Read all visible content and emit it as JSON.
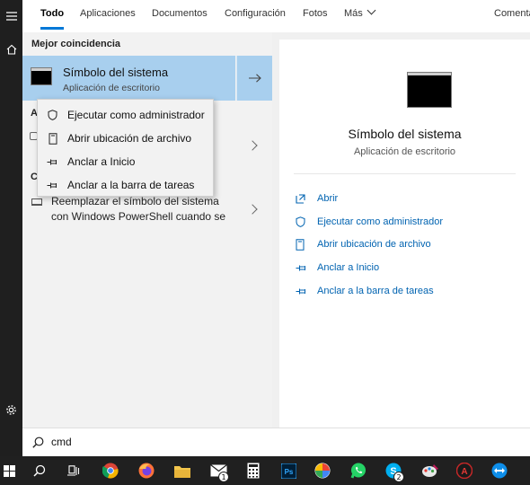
{
  "tabs": [
    {
      "label": "Todo",
      "active": true
    },
    {
      "label": "Aplicaciones"
    },
    {
      "label": "Documentos"
    },
    {
      "label": "Configuración"
    },
    {
      "label": "Fotos"
    },
    {
      "label": "Más"
    },
    {
      "label": "Comenta"
    }
  ],
  "results": {
    "best_match_title": "Mejor coincidencia",
    "best_match": {
      "title": "Símbolo del sistema",
      "subtitle": "Aplicación de escritorio"
    },
    "section_a_initial": "A",
    "section_c_initial": "C",
    "suggestion_line1": "Reemplazar el símbolo del sistema",
    "suggestion_line2": "con Windows PowerShell cuando se"
  },
  "context_menu": [
    {
      "label": "Ejecutar como administrador",
      "icon": "shield-icon"
    },
    {
      "label": "Abrir ubicación de archivo",
      "icon": "file-location-icon"
    },
    {
      "label": "Anclar a Inicio",
      "icon": "pin-icon"
    },
    {
      "label": "Anclar a la barra de tareas",
      "icon": "pin-icon"
    }
  ],
  "preview": {
    "title": "Símbolo del sistema",
    "subtitle": "Aplicación de escritorio",
    "actions": [
      {
        "label": "Abrir",
        "icon": "open-icon"
      },
      {
        "label": "Ejecutar como administrador",
        "icon": "shield-icon"
      },
      {
        "label": "Abrir ubicación de archivo",
        "icon": "file-location-icon"
      },
      {
        "label": "Anclar a Inicio",
        "icon": "pin-icon"
      },
      {
        "label": "Anclar a la barra de tareas",
        "icon": "pin-icon"
      }
    ]
  },
  "search": {
    "query": "cmd"
  },
  "taskbar": {
    "mail_badge": "1",
    "skype_badge": "2",
    "items": [
      "start-icon",
      "search-icon",
      "task-view-icon",
      "chrome-icon",
      "firefox-icon",
      "file-explorer-icon",
      "mail-icon",
      "calculator-icon",
      "photoshop-icon",
      "pinwheel-app-icon",
      "whatsapp-icon",
      "skype-icon",
      "paint-icon",
      "red-app-icon",
      "teamviewer-icon"
    ]
  },
  "colors": {
    "accent": "#0078d7",
    "selection": "#a8cfee",
    "link": "#0063b1",
    "taskbar": "#202020"
  }
}
